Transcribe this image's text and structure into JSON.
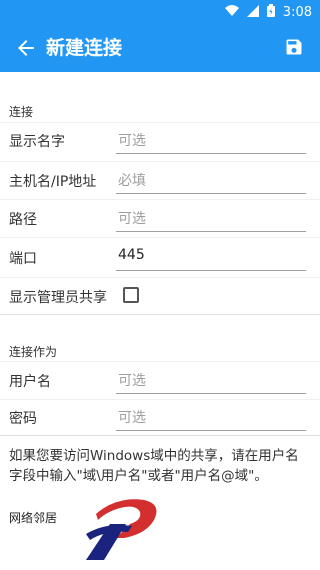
{
  "status_bar": {
    "time": "3:08",
    "icons": [
      "wifi-icon",
      "signal-icon",
      "battery-icon"
    ]
  },
  "app_bar": {
    "title": "新建连接",
    "back_icon": "arrow-left-icon",
    "save_icon": "save-icon",
    "color": "#2196f3"
  },
  "section_connection": {
    "header": "连接",
    "display_name": {
      "label": "显示名字",
      "placeholder": "可选",
      "value": ""
    },
    "host": {
      "label": "主机名/IP地址",
      "placeholder": "必填",
      "value": ""
    },
    "path": {
      "label": "路径",
      "placeholder": "可选",
      "value": ""
    },
    "port": {
      "label": "端口",
      "value": "445"
    },
    "show_admin_shares": {
      "label": "显示管理员共享",
      "checked": false
    }
  },
  "section_connect_as": {
    "header": "连接作为",
    "username": {
      "label": "用户名",
      "placeholder": "可选",
      "value": ""
    },
    "password": {
      "label": "密码",
      "placeholder": "可选",
      "value": ""
    }
  },
  "hint": "如果您要访问Windows域中的共享，请在用户名字段中输入\"域\\用户名\"或者\"用户名@域\"。",
  "footer": {
    "label": "网络邻居"
  }
}
